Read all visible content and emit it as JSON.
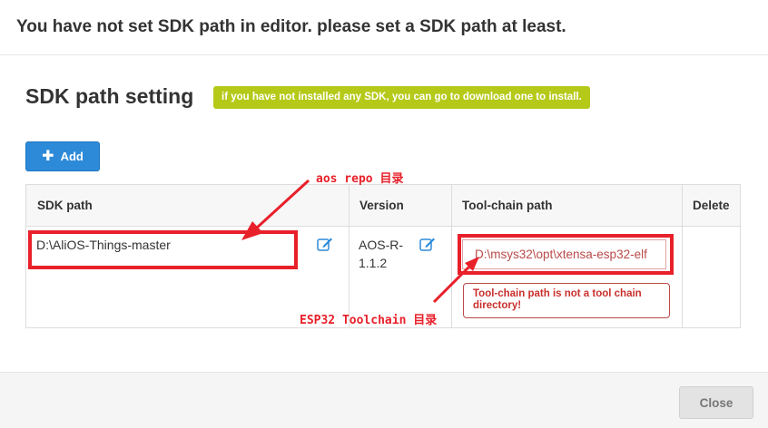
{
  "dialog": {
    "title": "You have not set SDK path in editor. please set a SDK path at least."
  },
  "section": {
    "title": "SDK path setting",
    "download_badge": "if you have not installed any SDK, you can go to download one to install."
  },
  "toolbar": {
    "add_icon": "plus-icon",
    "add_label": "Add"
  },
  "table": {
    "columns": [
      "SDK path",
      "Version",
      "Tool-chain path",
      "Delete"
    ],
    "rows": [
      {
        "sdk_path": "D:\\AliOS-Things-master",
        "version_line1": "AOS-R-",
        "version_line2": "1.1.2",
        "toolchain_path": "D:\\msys32\\opt\\xtensa-esp32-elf",
        "toolchain_error": "Tool-chain path is not a tool chain directory!"
      }
    ]
  },
  "annotations": {
    "aos_repo": "aos repo 目录",
    "esp32_toolchain": "ESP32 Toolchain 目录"
  },
  "footer": {
    "close_label": "Close"
  },
  "colors": {
    "accent_blue": "#2d8ad8",
    "badge_green": "#b5c918",
    "annotation_red": "#e8202a",
    "error_red": "#b94a48"
  }
}
